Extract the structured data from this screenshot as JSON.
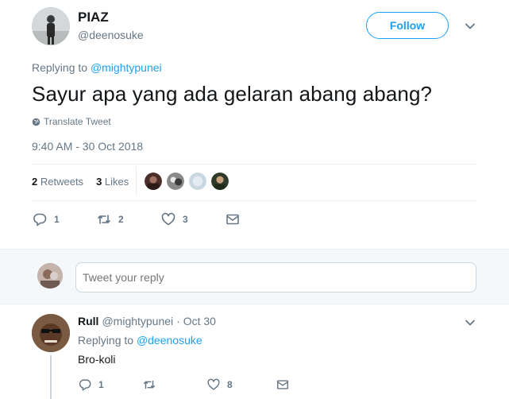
{
  "tweet": {
    "display_name": "PIAZ",
    "handle": "@deenosuke",
    "follow_label": "Follow",
    "replying_prefix": "Replying to",
    "replying_to": "@mightypunei",
    "text": "Sayur apa yang ada gelaran abang abang?",
    "translate_label": "Translate Tweet",
    "timestamp": "9:40 AM - 30 Oct 2018",
    "retweets_count": "2",
    "retweets_label": "Retweets",
    "likes_count": "3",
    "likes_label": "Likes",
    "actions": {
      "reply_count": "1",
      "retweet_count": "2",
      "like_count": "3"
    }
  },
  "compose": {
    "placeholder": "Tweet your reply"
  },
  "reply": {
    "display_name": "Rull",
    "handle": "@mightypunei",
    "time": "· Oct 30",
    "replying_prefix": "Replying to",
    "replying_to": "@deenosuke",
    "text": "Bro-koli",
    "actions": {
      "reply_count": "1",
      "retweet_count": "",
      "like_count": "8"
    }
  },
  "icons": {
    "caret": "chevron-down-icon",
    "globe": "globe-icon",
    "reply": "reply-icon",
    "retweet": "retweet-icon",
    "like": "heart-icon",
    "dm": "envelope-icon"
  },
  "colors": {
    "accent": "#1da1f2",
    "muted": "#657786",
    "text": "#14171a",
    "divider": "#e6ecf0",
    "band": "#f5f8fa"
  }
}
